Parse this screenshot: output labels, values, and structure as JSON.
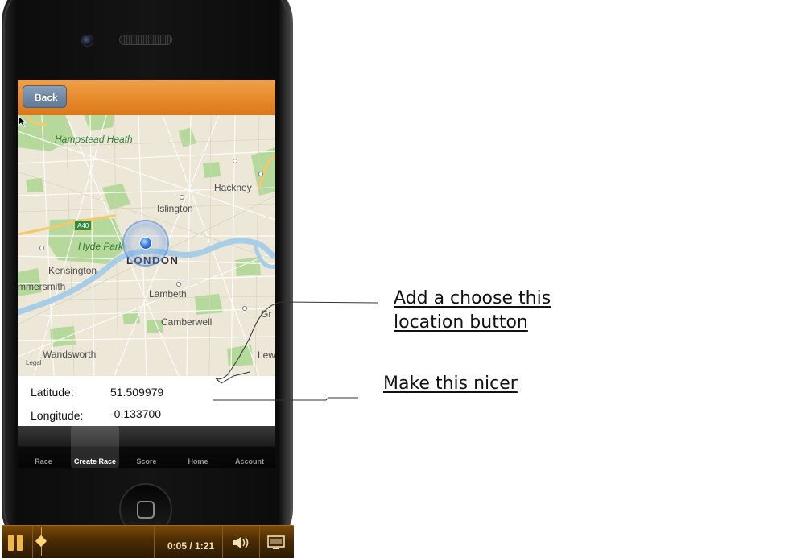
{
  "nav": {
    "back_label": "Back"
  },
  "map": {
    "labels": {
      "hampstead": "Hampstead Heath",
      "hackney": "Hackney",
      "islington": "Islington",
      "hyde_park": "Hyde Park",
      "london": "LONDON",
      "kensington": "Kensington",
      "hammersmith": "mmersmith",
      "lambeth": "Lambeth",
      "camberwell": "Camberwell",
      "wandsworth": "Wandsworth",
      "gr": "Gr",
      "lew": "Lew"
    },
    "road_badge": "A40",
    "legal": "Legal"
  },
  "coords": {
    "latitude_label": "Latitude:",
    "latitude_value": "51.509979",
    "longitude_label": "Longitude:",
    "longitude_value": "-0.133700"
  },
  "tabs": [
    {
      "label": "Race"
    },
    {
      "label": "Create Race",
      "active": true
    },
    {
      "label": "Score"
    },
    {
      "label": "Home"
    },
    {
      "label": "Account"
    }
  ],
  "player": {
    "time": "0:05 / 1:21",
    "progress": 0.062
  },
  "annotations": {
    "choose_location": "Add a choose this location button",
    "choose_location_line1": "Add a choose this",
    "choose_location_line2": "location button",
    "nicer": "Make this nicer"
  },
  "colors": {
    "nav_orange": "#e68a2a",
    "player_amber": "#f0b840",
    "map_water": "#a8cde6",
    "map_park": "#a8d48c"
  }
}
